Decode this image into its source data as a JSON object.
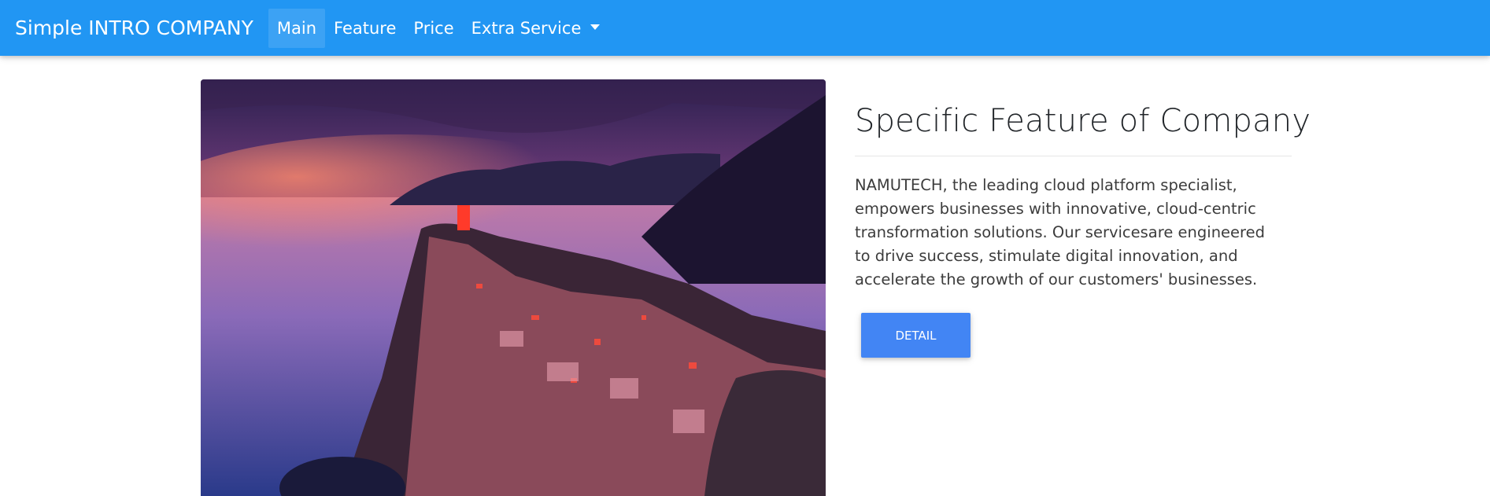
{
  "navbar": {
    "brand": "Simple INTRO COMPANY",
    "links": [
      {
        "label": "Main",
        "active": true
      },
      {
        "label": "Feature",
        "active": false
      },
      {
        "label": "Price",
        "active": false
      },
      {
        "label": "Extra Service",
        "active": false,
        "dropdown": true
      }
    ],
    "bg_color": "#2196f3"
  },
  "hero": {
    "image_subject": "coastal-village-sunset-photo"
  },
  "content": {
    "title": "Specific Feature of Company",
    "description": "NAMUTECH, the leading cloud platform specialist, empowers businesses with innovative, cloud-centric transformation solutions. Our servicesare engineered to drive success, stimulate digital innovation, and accelerate the growth of our customers' businesses.",
    "button_label": "DETAIL",
    "button_color": "#4285f4"
  }
}
